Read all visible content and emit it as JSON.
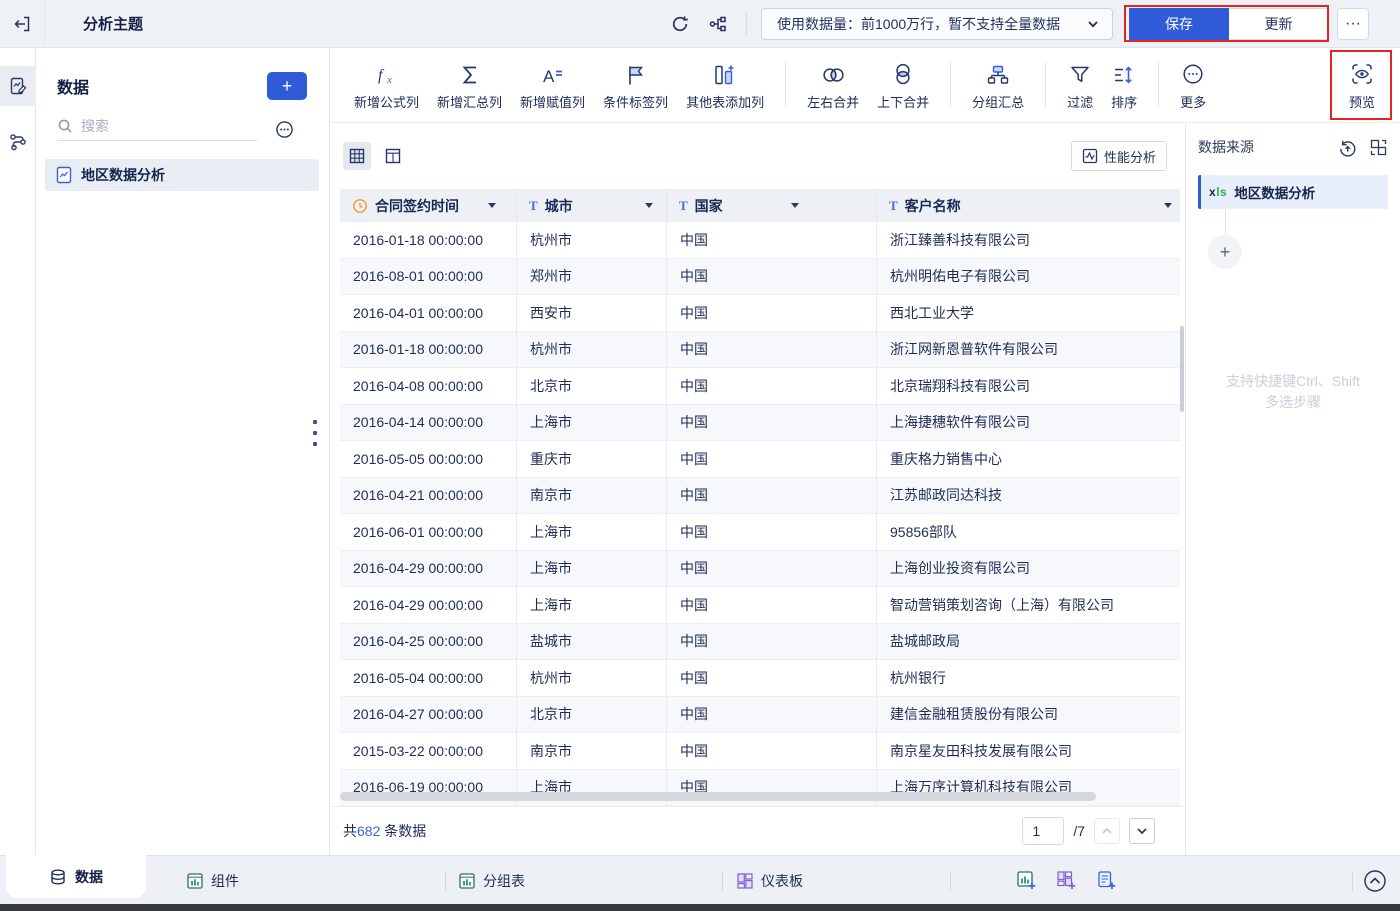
{
  "topbar": {
    "title": "分析主题",
    "data_volume_label": "使用数据量：前1000万行，暂不支持全量数据",
    "save_label": "保存",
    "update_label": "更新",
    "more_label": "···"
  },
  "sidebar": {
    "panel_title": "数据",
    "add_label": "+",
    "search_placeholder": "搜索",
    "items": [
      {
        "label": "地区数据分析",
        "selected": true
      }
    ]
  },
  "toolbar": {
    "groups": [
      {
        "items": [
          {
            "label": "新增公式列"
          },
          {
            "label": "新增汇总列"
          },
          {
            "label": "新增赋值列"
          },
          {
            "label": "条件标签列"
          },
          {
            "label": "其他表添加列"
          }
        ]
      },
      {
        "items": [
          {
            "label": "左右合并"
          },
          {
            "label": "上下合并"
          }
        ]
      },
      {
        "items": [
          {
            "label": "分组汇总"
          }
        ]
      },
      {
        "items": [
          {
            "label": "过滤"
          },
          {
            "label": "排序"
          }
        ]
      },
      {
        "items": [
          {
            "label": "更多"
          }
        ]
      }
    ],
    "preview_label": "预览"
  },
  "view_bar": {
    "performance_label": "性能分析"
  },
  "table": {
    "columns": [
      {
        "label": "合同签约时间",
        "type": "date"
      },
      {
        "label": "城市",
        "type": "text"
      },
      {
        "label": "国家",
        "type": "text"
      },
      {
        "label": "客户名称",
        "type": "text"
      }
    ],
    "rows": [
      [
        "2016-01-18 00:00:00",
        "杭州市",
        "中国",
        "浙江臻善科技有限公司"
      ],
      [
        "2016-08-01 00:00:00",
        "郑州市",
        "中国",
        "杭州明佑电子有限公司"
      ],
      [
        "2016-04-01 00:00:00",
        "西安市",
        "中国",
        "西北工业大学"
      ],
      [
        "2016-01-18 00:00:00",
        "杭州市",
        "中国",
        "浙江网新恩普软件有限公司"
      ],
      [
        "2016-04-08 00:00:00",
        "北京市",
        "中国",
        "北京瑞翔科技有限公司"
      ],
      [
        "2016-04-14 00:00:00",
        "上海市",
        "中国",
        "上海捷穗软件有限公司"
      ],
      [
        "2016-05-05 00:00:00",
        "重庆市",
        "中国",
        "重庆格力销售中心"
      ],
      [
        "2016-04-21 00:00:00",
        "南京市",
        "中国",
        "江苏邮政同达科技"
      ],
      [
        "2016-06-01 00:00:00",
        "上海市",
        "中国",
        "95856部队"
      ],
      [
        "2016-04-29 00:00:00",
        "上海市",
        "中国",
        "上海创业投资有限公司"
      ],
      [
        "2016-04-29 00:00:00",
        "上海市",
        "中国",
        "智动营销策划咨询（上海）有限公司"
      ],
      [
        "2016-04-25 00:00:00",
        "盐城市",
        "中国",
        "盐城邮政局"
      ],
      [
        "2016-05-04 00:00:00",
        "杭州市",
        "中国",
        "杭州银行"
      ],
      [
        "2016-04-27 00:00:00",
        "北京市",
        "中国",
        "建信金融租赁股份有限公司"
      ],
      [
        "2015-03-22 00:00:00",
        "南京市",
        "中国",
        "南京星友田科技发展有限公司"
      ],
      [
        "2016-06-19 00:00:00",
        "上海市",
        "中国",
        "上海万序计算机科技有限公司"
      ]
    ]
  },
  "footer": {
    "total_prefix": "共",
    "total_count": "682",
    "total_suffix": "条数据",
    "page_input": "1",
    "page_total": "/7"
  },
  "source_panel": {
    "title": "数据来源",
    "source_type": "xls",
    "source_label": "地区数据分析",
    "add_label": "+",
    "hint_line1": "支持快捷键Ctrl、Shift",
    "hint_line2": "多选步骤"
  },
  "bottombar": {
    "tabs": [
      {
        "label": "数据"
      },
      {
        "label": "组件"
      },
      {
        "label": "分组表"
      },
      {
        "label": "仪表板"
      }
    ]
  },
  "colors": {
    "accent_blue": "#2F5BD8",
    "annotation_red": "#E2251F",
    "clock_orange": "#EE9A2C",
    "xls_green": "#2FA84F",
    "teal_icon": "#2F6F63",
    "purple_icon": "#7B5FD6"
  }
}
